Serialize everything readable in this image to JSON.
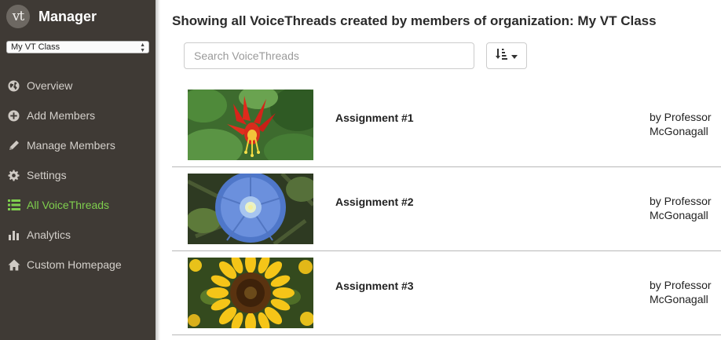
{
  "app": {
    "logo_text": "vt",
    "title": "Manager"
  },
  "org_selector": {
    "selected": "My VT Class"
  },
  "nav": {
    "items": [
      {
        "label": "Overview",
        "icon": "globe-icon",
        "active": false
      },
      {
        "label": "Add Members",
        "icon": "plus-circle-icon",
        "active": false
      },
      {
        "label": "Manage Members",
        "icon": "pencil-icon",
        "active": false
      },
      {
        "label": "Settings",
        "icon": "gear-icon",
        "active": false
      },
      {
        "label": "All VoiceThreads",
        "icon": "list-icon",
        "active": true
      },
      {
        "label": "Analytics",
        "icon": "bar-chart-icon",
        "active": false
      },
      {
        "label": "Custom Homepage",
        "icon": "home-icon",
        "active": false
      }
    ]
  },
  "main": {
    "heading": "Showing all VoiceThreads created by members of organization: My VT Class",
    "search_placeholder": "Search VoiceThreads",
    "sort_icon": "sort-amount-icon"
  },
  "threads": [
    {
      "title": "Assignment #1",
      "author_line1": "by Professor",
      "author_line2": "McGonagall",
      "thumbnail": "red-columbine-flower"
    },
    {
      "title": "Assignment #2",
      "author_line1": "by Professor",
      "author_line2": "McGonagall",
      "thumbnail": "blue-morning-glory-flower"
    },
    {
      "title": "Assignment #3",
      "author_line1": "by Professor",
      "author_line2": "McGonagall",
      "thumbnail": "sunflower"
    }
  ],
  "colors": {
    "sidebar_bg": "#3f3a35",
    "active_nav": "#7fcf4e",
    "nav_text": "#d4d0cb"
  }
}
